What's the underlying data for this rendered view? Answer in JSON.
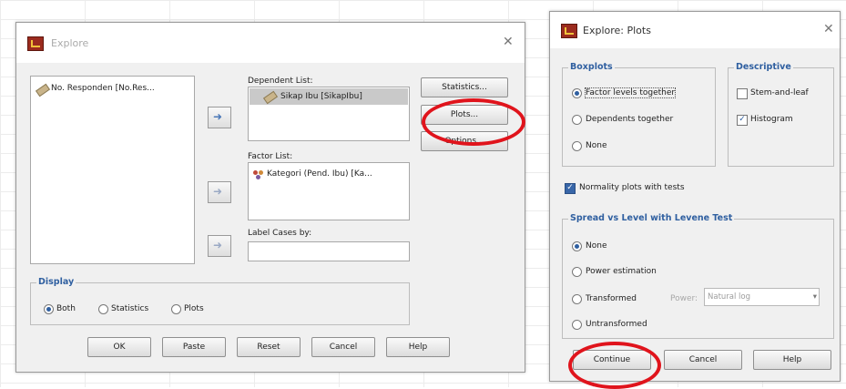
{
  "explore": {
    "title": "Explore",
    "close": "✕",
    "variables": [
      "No. Responden [No.Res..."
    ],
    "dependent_list_label": "Dependent List:",
    "dependent_items": [
      "Sikap Ibu [SikapIbu]"
    ],
    "factor_list_label": "Factor List:",
    "factor_items": [
      "Kategori (Pend. Ibu) [Ka..."
    ],
    "label_cases_label": "Label Cases by:",
    "label_cases_value": "",
    "side_buttons": {
      "statistics": "Statistics...",
      "plots": "Plots...",
      "options": "Options..."
    },
    "display": {
      "title": "Display",
      "options": [
        "Both",
        "Statistics",
        "Plots"
      ],
      "selected": "Both"
    },
    "bottom_buttons": {
      "ok": "OK",
      "paste": "Paste",
      "reset": "Reset",
      "cancel": "Cancel",
      "help": "Help"
    }
  },
  "plots": {
    "title": "Explore: Plots",
    "close": "✕",
    "boxplots": {
      "title": "Boxplots",
      "options": [
        "Factor levels together",
        "Dependents together",
        "None"
      ],
      "selected": "Factor levels together"
    },
    "descriptive": {
      "title": "Descriptive",
      "stem_and_leaf": {
        "label": "Stem-and-leaf",
        "checked": false
      },
      "histogram": {
        "label": "Histogram",
        "checked": true
      }
    },
    "normality": {
      "label": "Normality plots with tests",
      "checked": true
    },
    "spread": {
      "title": "Spread vs Level with Levene Test",
      "options": [
        "None",
        "Power estimation",
        "Transformed",
        "Untransformed"
      ],
      "selected": "None",
      "power_label": "Power:",
      "power_value": "Natural log"
    },
    "buttons": {
      "continue": "Continue",
      "cancel": "Cancel",
      "help": "Help"
    }
  },
  "colors": {
    "highlight_ring": "#e0141c",
    "group_title": "#2f5fa0"
  }
}
